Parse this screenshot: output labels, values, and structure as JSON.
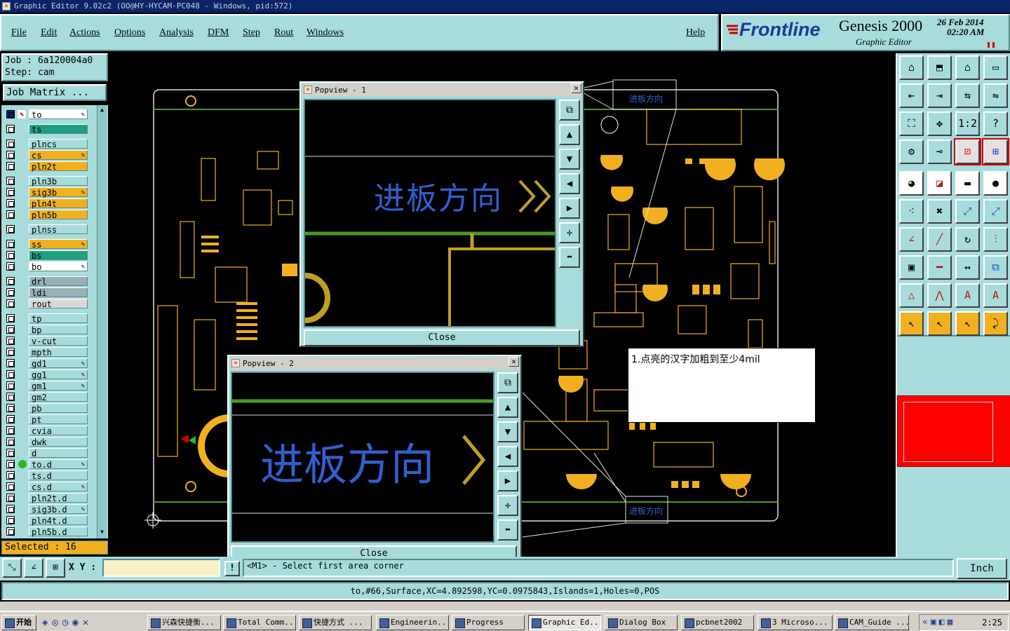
{
  "title": "Graphic Editor 9.02c2 (OO@HY-HYCAM-PC048 - Windows, pid:572)",
  "menu": {
    "file": "File",
    "edit": "Edit",
    "actions": "Actions",
    "options": "Options",
    "analysis": "Analysis",
    "dfm": "DFM",
    "step": "Step",
    "rout": "Rout",
    "windows": "Windows",
    "help": "Help"
  },
  "brand": {
    "logo": "Frontline",
    "product": "Genesis 2000",
    "subtitle": "Graphic Editor",
    "date": "26 Feb 2014",
    "time": "02:20 AM"
  },
  "job": {
    "job_line": "Job : 6a120004a0",
    "step_line": "Step: cam",
    "matrix_button": "Job Matrix ..."
  },
  "layers": [
    {
      "name": "to",
      "color": "#ffffff",
      "active": true,
      "editable": true
    },
    {
      "name": "ts",
      "color": "#20a080"
    },
    {
      "name": "plncs",
      "color": "#a8dcdc"
    },
    {
      "name": "cs",
      "color": "#f0b020",
      "editable": true
    },
    {
      "name": "pln2t",
      "color": "#f0b020"
    },
    {
      "name": "pln3b",
      "color": "#a8dcdc"
    },
    {
      "name": "sig3b",
      "color": "#f0b020",
      "editable": true
    },
    {
      "name": "pln4t",
      "color": "#f0b020"
    },
    {
      "name": "pln5b",
      "color": "#f0b020"
    },
    {
      "name": "plnss",
      "color": "#a8dcdc"
    },
    {
      "name": "ss",
      "color": "#f0b020",
      "editable": true
    },
    {
      "name": "bs",
      "color": "#20a080"
    },
    {
      "name": "bo",
      "color": "#ffffff",
      "editable": true
    },
    {
      "name": "drl",
      "color": "#98b0b8"
    },
    {
      "name": "ldi",
      "color": "#98b0b8"
    },
    {
      "name": "rout",
      "color": "#d8d8d8"
    },
    {
      "name": "tp",
      "color": "#a8dcdc"
    },
    {
      "name": "bp",
      "color": "#a8dcdc"
    },
    {
      "name": "v-cut",
      "color": "#a8dcdc"
    },
    {
      "name": "mpth",
      "color": "#a8dcdc"
    },
    {
      "name": "gd1",
      "color": "#a8dcdc",
      "editable": true
    },
    {
      "name": "gg1",
      "color": "#a8dcdc",
      "editable": true
    },
    {
      "name": "gm1",
      "color": "#a8dcdc",
      "editable": true
    },
    {
      "name": "gm2",
      "color": "#a8dcdc"
    },
    {
      "name": "pb",
      "color": "#a8dcdc"
    },
    {
      "name": "pt",
      "color": "#a8dcdc"
    },
    {
      "name": "cvia",
      "color": "#a8dcdc"
    },
    {
      "name": "dwk",
      "color": "#a8dcdc"
    },
    {
      "name": "d",
      "color": "#a8dcdc"
    },
    {
      "name": "to.d",
      "color": "#a8dcdc",
      "editable": true,
      "dot": true
    },
    {
      "name": "ts.d",
      "color": "#a8dcdc"
    },
    {
      "name": "cs.d",
      "color": "#a8dcdc",
      "editable": true
    },
    {
      "name": "pln2t.d",
      "color": "#a8dcdc"
    },
    {
      "name": "sig3b.d",
      "color": "#a8dcdc",
      "editable": true
    },
    {
      "name": "pln4t.d",
      "color": "#a8dcdc"
    },
    {
      "name": "pln5b.d",
      "color": "#a8dcdc"
    }
  ],
  "selected": "Selected : 16",
  "popview1": {
    "title": "Popview - 1",
    "text": "进板方向",
    "close": "Close"
  },
  "popview2": {
    "title": "Popview - 2",
    "text": "进板方向",
    "close": "Close"
  },
  "board_label": "进板方向",
  "note": "1.点亮的汉字加粗到至少4mil",
  "status": {
    "xy_label": "X Y :",
    "xy_value": "",
    "prompt": "<M1> - Select first area corner",
    "units": "Inch",
    "info": "to,#66,Surface,XC=4.892598,YC=0.0975843,Islands=1,Holes=0,POS"
  },
  "taskbar": {
    "start": "开始",
    "items": [
      "兴森快捷衡...",
      "Total Comm...",
      "快捷方式 ...",
      "Engineerin...",
      "Progress",
      "Graphic Ed...",
      "Dialog Box",
      "pcbnet2002",
      "3 Microso...",
      "CAM_Guide ..."
    ],
    "clock": "2:25"
  },
  "colors": {
    "panel": "#a8dcdc",
    "accent": "#f0b020",
    "board_outline": "#e0e0e0",
    "silk": "#f0b020",
    "green": "#4a9a20",
    "blue_text": "#3060d0"
  }
}
